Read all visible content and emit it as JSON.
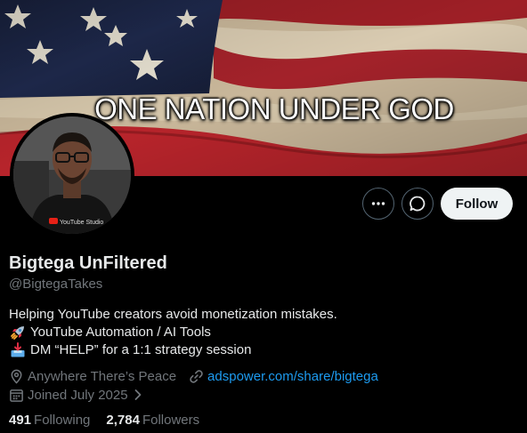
{
  "banner": {
    "caption": "ONE NATION UNDER GOD"
  },
  "profile": {
    "name": "Bigtega UnFiltered",
    "handle": "@BigtegaTakes",
    "avatar_shirt_text": "YouTube Studio"
  },
  "actions": {
    "more_icon": "ellipsis-icon",
    "message_icon": "chat-bubble-icon",
    "follow_label": "Follow"
  },
  "bio": {
    "line1": "Helping YouTube creators avoid monetization mistakes.",
    "line2_emoji": "rocket",
    "line2": "YouTube Automation / AI Tools",
    "line3_emoji": "inbox-tray",
    "line3": "DM “HELP” for a 1:1 strategy session"
  },
  "meta": {
    "location": "Anywhere There’s Peace",
    "website": "adspower.com/share/bigtega",
    "joined": "Joined July 2025"
  },
  "stats": {
    "following_count": "491",
    "following_label": "Following",
    "followers_count": "2,784",
    "followers_label": "Followers"
  },
  "colors": {
    "background": "#000000",
    "text_primary": "#e7e9ea",
    "text_secondary": "#71767b",
    "link": "#1d9bf0",
    "follow_button_bg": "#eff3f4"
  }
}
